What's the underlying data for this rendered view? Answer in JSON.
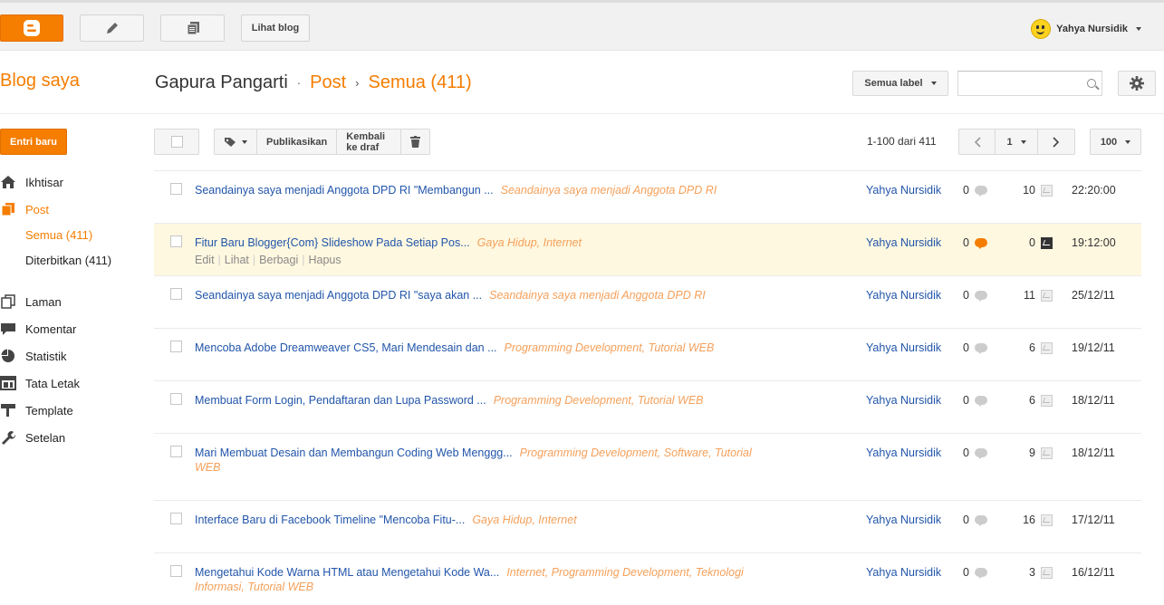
{
  "topbar": {
    "view_blog_label": "Lihat blog",
    "user_name": "Yahya Nursidik"
  },
  "header": {
    "my_blogs": "Blog saya",
    "blog_name": "Gapura Pangarti",
    "sep1": "·",
    "section": "Post",
    "sep2": "›",
    "filter": "Semua (411)",
    "label_filter": "Semua label",
    "search_placeholder": ""
  },
  "sidebar": {
    "new_post": "Entri baru",
    "items": [
      {
        "label": "Ikhtisar",
        "icon": "home-icon"
      },
      {
        "label": "Post",
        "icon": "posts-icon",
        "active": true
      },
      {
        "label": "Laman",
        "icon": "pages-icon"
      },
      {
        "label": "Komentar",
        "icon": "comment-icon"
      },
      {
        "label": "Statistik",
        "icon": "stats-icon"
      },
      {
        "label": "Tata Letak",
        "icon": "layout-icon"
      },
      {
        "label": "Template",
        "icon": "template-icon"
      },
      {
        "label": "Setelan",
        "icon": "wrench-icon"
      }
    ],
    "sub_items": [
      "Semua (411)",
      "Diterbitkan (411)"
    ]
  },
  "toolbar": {
    "publish": "Publikasikan",
    "revert": "Kembali ke draf",
    "count": "1-100 dari 411",
    "page": "1",
    "per_page": "100"
  },
  "posts": [
    {
      "title": "Seandainya saya menjadi Anggota DPD RI \"Membangun ...",
      "labels": "Seandainya saya menjadi Anggota DPD RI",
      "labels2": "",
      "author": "Yahya Nursidik",
      "comments": "0",
      "views": "10",
      "time": "22:20:00"
    },
    {
      "title": "Fitur Baru Blogger{Com} Slideshow Pada Setiap Pos...",
      "labels": "Gaya Hidup, Internet",
      "labels2": "",
      "author": "Yahya Nursidik",
      "comments": "0",
      "views": "0",
      "time": "19:12:00",
      "actions": [
        "Edit",
        "Lihat",
        "Berbagi",
        "Hapus"
      ]
    },
    {
      "title": "Seandainya saya menjadi Anggota DPD RI \"saya akan ...",
      "labels": "Seandainya saya menjadi Anggota DPD RI",
      "labels2": "",
      "author": "Yahya Nursidik",
      "comments": "0",
      "views": "11",
      "time": "25/12/11"
    },
    {
      "title": "Mencoba Adobe Dreamweaver CS5, Mari Mendesain dan ...",
      "labels": "Programming Development, Tutorial WEB",
      "labels2": "",
      "author": "Yahya Nursidik",
      "comments": "0",
      "views": "6",
      "time": "19/12/11"
    },
    {
      "title": "Membuat Form Login, Pendaftaran dan Lupa Password ...",
      "labels": "Programming Development, Tutorial WEB",
      "labels2": "",
      "author": "Yahya Nursidik",
      "comments": "0",
      "views": "6",
      "time": "18/12/11"
    },
    {
      "title": "Mari Membuat Desain dan Membangun Coding Web Menggg...",
      "labels": "Programming Development, Software, Tutorial",
      "labels2": "WEB",
      "author": "Yahya Nursidik",
      "comments": "0",
      "views": "9",
      "time": "18/12/11"
    },
    {
      "title": "Interface Baru di Facebook Timeline \"Mencoba Fitu-...",
      "labels": "Gaya Hidup, Internet",
      "labels2": "",
      "author": "Yahya Nursidik",
      "comments": "0",
      "views": "16",
      "time": "17/12/11"
    },
    {
      "title": "Mengetahui Kode Warna HTML atau Mengetahui Kode Wa...",
      "labels": "Internet, Programming Development, Teknologi",
      "labels2": "Informasi, Tutorial WEB",
      "author": "Yahya Nursidik",
      "comments": "0",
      "views": "3",
      "time": "16/12/11"
    }
  ],
  "colors": {
    "accent": "#f57d00",
    "link": "#2255aa",
    "label": "#f5a05a",
    "highlight_row": "#fff8e0"
  }
}
